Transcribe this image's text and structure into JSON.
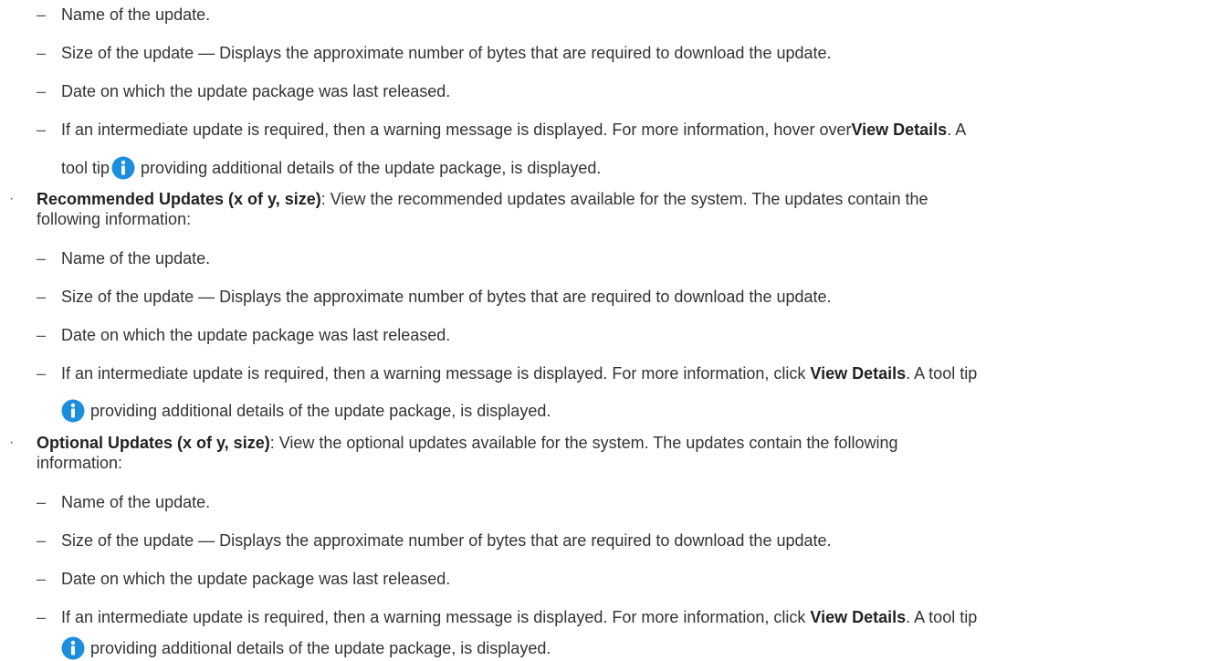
{
  "common": {
    "item_name": "Name of the update.",
    "item_size": "Size of the update — Displays the approximate number of bytes that are required to download the update.",
    "item_date": "Date on which the update package was last released.",
    "item_warning_pre": "If an intermediate update is required, then a warning message is displayed. For more information, ",
    "view_details": "View Details",
    "tool_tip_text": "tool tip",
    "tip_after": "providing additional details of the update package, is displayed.",
    "a_tool_tip": ". A tool tip",
    "a_suffix": ". A",
    "info_icon_color": "#1c8ede"
  },
  "first_block": {
    "hover_over": "hover over"
  },
  "recommended": {
    "title": "Recommended Updates (x of y, size)",
    "description": ": View the recommended updates available for the system. The updates contain the",
    "description_cont": "following information:",
    "click": "click "
  },
  "optional": {
    "title": "Optional Updates (x of y, size)",
    "description": ": View the optional updates available for the system. The updates contain the following",
    "description_cont": "information:",
    "click": "click "
  }
}
